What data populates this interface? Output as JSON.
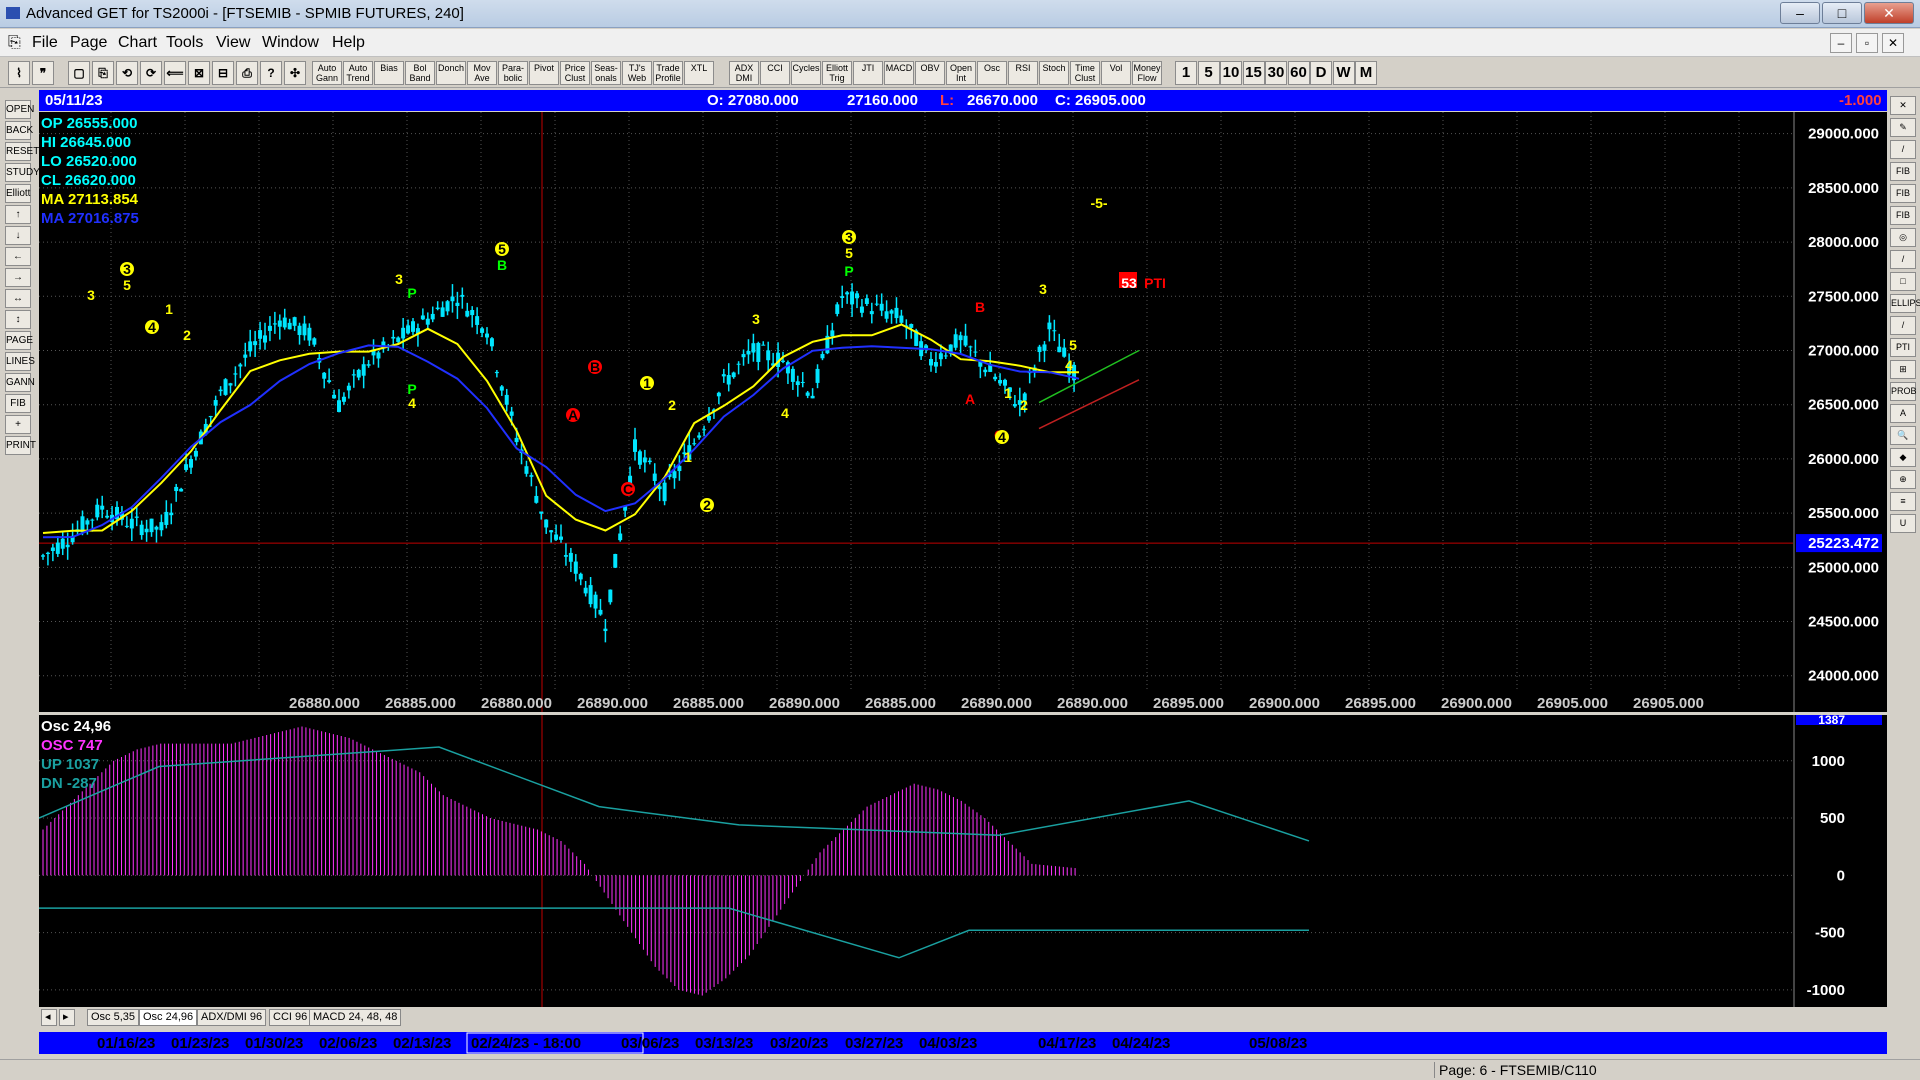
{
  "window": {
    "title": "Advanced GET for TS2000i - [FTSEMIB - SPMIB FUTURES, 240]"
  },
  "menu": [
    "File",
    "Page",
    "Chart",
    "Tools",
    "View",
    "Window",
    "Help"
  ],
  "toolbar": {
    "studies": [
      "Auto Gann",
      "Auto Trend",
      "Bias",
      "Bol Band",
      "Donch",
      "Mov Ave",
      "Para-bolic",
      "Pivot",
      "Price Clust",
      "Seas-onals",
      "TJ's Web",
      "Trade Profile",
      "XTL",
      "ADX DMI",
      "CCI",
      "Cycles",
      "Elliott Trig",
      "JTI",
      "MACD",
      "OBV",
      "Open Int",
      "Osc",
      "RSI",
      "Stoch",
      "Time Clust",
      "Vol",
      "Money Flow"
    ],
    "timeframes": [
      "1",
      "5",
      "10",
      "15",
      "30",
      "60",
      "D",
      "W",
      "M"
    ]
  },
  "left_tools": [
    "OPEN",
    "BACK",
    "RESET",
    "STUDY",
    "Elliott",
    "↑",
    "↓",
    "←",
    "→",
    "↔",
    "↕",
    "PAGE",
    "LINES",
    "GANN",
    "FIB",
    "+",
    "PRINT"
  ],
  "right_tools": [
    "✕",
    "✎",
    "/",
    "FIB RET",
    "FIB EXT",
    "FIB TIME",
    "◎",
    "/",
    "□",
    "ELLIPS",
    "/",
    "PTI",
    "⊞",
    "PROB",
    "A",
    "🔍",
    "◆",
    "⊕",
    "≡",
    "U"
  ],
  "price_bar": {
    "date": "05/11/23",
    "open": "O: 27080.000",
    "high": "27160.000",
    "low_label": "L:",
    "low": "26670.000",
    "close": "C: 26905.000",
    "change": "-1.000"
  },
  "info": {
    "op": "OP  26555.000",
    "hi": "HI   26645.000",
    "lo": "LO  26520.000",
    "cl": "CL  26620.000",
    "ma1": "MA  27113.854",
    "ma2": "MA  27016.875"
  },
  "chart_data": [
    {
      "type": "candlestick",
      "title": "FTSEMIB - SPMIB FUTURES, 240",
      "y_axis_labels": [
        "29000.000",
        "28500.000",
        "28000.000",
        "27500.000",
        "27000.000",
        "26500.000",
        "26000.000",
        "25500.000",
        "25000.000",
        "24500.000",
        "24000.000"
      ],
      "ylim": [
        23850,
        29200
      ],
      "current_level": "25223.472",
      "bottom_labels": [
        "26880.000",
        "26885.000",
        "26880.000",
        "26890.000",
        "26885.000",
        "26890.000",
        "26885.000",
        "26890.000",
        "26890.000",
        "26895.000",
        "26900.000",
        "26895.000",
        "26900.000",
        "26905.000",
        "26905.000"
      ],
      "approx_closes": [
        25100,
        25300,
        25550,
        25400,
        25350,
        26000,
        26600,
        27000,
        27300,
        27150,
        26500,
        26900,
        27100,
        27300,
        27500,
        27200,
        26200,
        25400,
        25000,
        24500,
        26100,
        25700,
        26150,
        26700,
        27000,
        26900,
        26600,
        27500,
        27400,
        27300,
        26900,
        27100,
        26800,
        26500,
        27200,
        26700
      ],
      "labels": [
        {
          "t": "3",
          "c": "#ffff00"
        },
        {
          "t": "3",
          "c": "#ffff00"
        },
        {
          "t": "5",
          "c": "#ffff00"
        },
        {
          "t": "4",
          "c": "#ffff00"
        },
        {
          "t": "1",
          "c": "#ffff00"
        },
        {
          "t": "2",
          "c": "#ffff00"
        },
        {
          "t": "3",
          "c": "#ffff00"
        },
        {
          "t": "P",
          "c": "#00ff00"
        },
        {
          "t": "P",
          "c": "#00ff00"
        },
        {
          "t": "4",
          "c": "#ffff00"
        },
        {
          "t": "5",
          "c": "#ffff00"
        },
        {
          "t": "B",
          "c": "#00ff00"
        },
        {
          "t": "B",
          "c": "#ff0000"
        },
        {
          "t": "A",
          "c": "#ff0000"
        },
        {
          "t": "C",
          "c": "#ff0000"
        },
        {
          "t": "1",
          "c": "#ffff00"
        },
        {
          "t": "2",
          "c": "#ffff00"
        },
        {
          "t": "1",
          "c": "#ffff00"
        },
        {
          "t": "2",
          "c": "#ffff00"
        },
        {
          "t": "3",
          "c": "#ffff00"
        },
        {
          "t": "4",
          "c": "#ffff00"
        },
        {
          "t": "3",
          "c": "#ffff00"
        },
        {
          "t": "5",
          "c": "#ffff00"
        },
        {
          "t": "P",
          "c": "#00ff00"
        },
        {
          "t": "B",
          "c": "#ff0000"
        },
        {
          "t": "A",
          "c": "#ff0000"
        },
        {
          "t": "C",
          "c": "#ff0000"
        },
        {
          "t": "1",
          "c": "#ffff00"
        },
        {
          "t": "2",
          "c": "#ffff00"
        },
        {
          "t": "4",
          "c": "#ffff00"
        },
        {
          "t": "3",
          "c": "#ffff00"
        },
        {
          "t": "5",
          "c": "#ffff00"
        },
        {
          "t": "4",
          "c": "#ffff00"
        },
        {
          "t": "-5-",
          "c": "#ffff00"
        },
        {
          "t": "53",
          "c": "#ff0000"
        },
        {
          "t": "PTI",
          "c": "#ff0000"
        }
      ]
    },
    {
      "type": "bar",
      "title": "Osc 24,96",
      "legend": [
        "OSC 747",
        "UP  1037",
        "DN  -287"
      ],
      "y_axis_labels": [
        "1000",
        "500",
        "0",
        "-500",
        "-1000"
      ],
      "top_label": "1387",
      "ylim": [
        -1150,
        1400
      ],
      "approx_values": [
        400,
        600,
        800,
        1000,
        1100,
        1150,
        1150,
        1150,
        1150,
        1200,
        1250,
        1300,
        1250,
        1200,
        1100,
        1000,
        900,
        700,
        600,
        500,
        450,
        400,
        300,
        100,
        -200,
        -500,
        -800,
        -1000,
        -1050,
        -900,
        -700,
        -400,
        -100,
        200,
        400,
        600,
        700,
        800,
        750,
        650,
        500,
        300,
        100,
        80,
        60
      ]
    }
  ],
  "osc_tabs": [
    "Osc 5,35",
    "Osc 24,96",
    "ADX/DMI 96",
    "CCI 96",
    "MACD 24, 48, 48"
  ],
  "dates": [
    "01/16/23",
    "01/23/23",
    "01/30/23",
    "02/06/23",
    "02/13/23",
    "02/24/23 - 18:00",
    "03/06/23",
    "03/13/23",
    "03/20/23",
    "03/27/23",
    "04/03/23",
    "04/17/23",
    "04/24/23",
    "05/08/23"
  ],
  "status": {
    "page": "Page: 6 - FTSEMIB/C110"
  },
  "colors": {
    "chart_bg": "#000000",
    "bars": "#00e5ff",
    "ma_fast": "#ffff00",
    "ma_slow": "#2030ff",
    "osc": "#ff33ff",
    "band": "#1aa0a0",
    "bar_blue": "#0000ff"
  }
}
